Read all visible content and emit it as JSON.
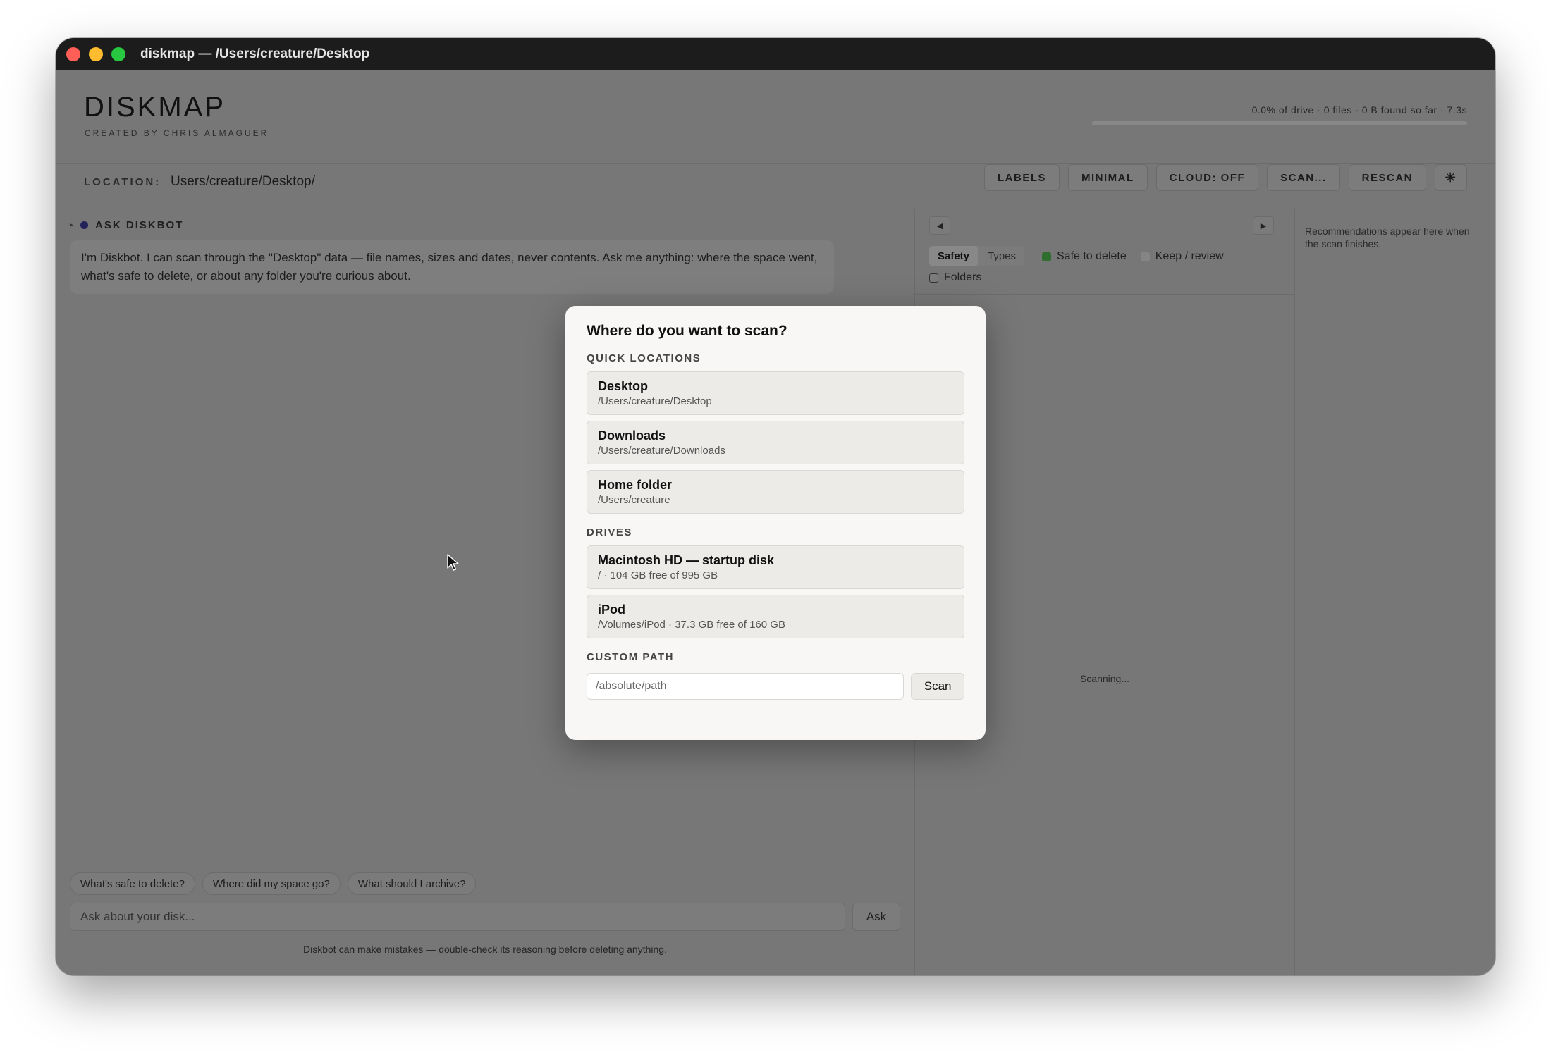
{
  "window": {
    "title": "diskmap — /Users/creature/Desktop"
  },
  "header": {
    "title": "DISKMAP",
    "subtitle": "CREATED BY CHRIS ALMAGUER",
    "scan_status": "0.0% of drive · 0 files · 0 B found so far · 7.3s",
    "scan_progress_percent": 0
  },
  "location": {
    "label": "LOCATION:",
    "path": "Users/creature/Desktop/"
  },
  "toolbar": {
    "labels": "LABELS",
    "minimal": "MINIMAL",
    "cloud": "CLOUD: OFF",
    "scan": "SCAN...",
    "rescan": "RESCAN",
    "theme_icon": "☀"
  },
  "chat": {
    "caret": "▸",
    "title": "ASK DISKBOT",
    "message": "I'm Diskbot. I can scan through the \"Desktop\" data — file names, sizes and dates, never contents. Ask me anything: where the space went, what's safe to delete, or about any folder you're curious about.",
    "suggestions": [
      "What's safe to delete?",
      "Where did my space go?",
      "What should I archive?"
    ],
    "input_placeholder": "Ask about your disk...",
    "ask_label": "Ask",
    "disclaimer": "Diskbot can make mistakes — double-check its reasoning before deleting anything."
  },
  "map": {
    "prev_icon": "◀",
    "next_icon": "▶",
    "tabs": [
      {
        "label": "Safety",
        "active": true
      },
      {
        "label": "Types",
        "active": false
      }
    ],
    "legend": [
      {
        "label": "Safe to delete",
        "color": "#2f6e2f"
      },
      {
        "label": "Keep / review",
        "color": "#858585"
      }
    ],
    "folders_label": "Folders",
    "status": "Scanning..."
  },
  "recommendations": {
    "text": "Recommendations appear here when the scan finishes."
  },
  "modal": {
    "title": "Where do you want to scan?",
    "quick_label": "QUICK LOCATIONS",
    "quick": [
      {
        "name": "Desktop",
        "path": "/Users/creature/Desktop"
      },
      {
        "name": "Downloads",
        "path": "/Users/creature/Downloads"
      },
      {
        "name": "Home folder",
        "path": "/Users/creature"
      }
    ],
    "drives_label": "DRIVES",
    "drives": [
      {
        "name": "Macintosh HD — startup disk",
        "path": "/ · 104 GB free of 995 GB"
      },
      {
        "name": "iPod",
        "path": "/Volumes/iPod · 37.3 GB free of 160 GB"
      }
    ],
    "custom_label": "CUSTOM PATH",
    "custom_placeholder": "/absolute/path",
    "scan_label": "Scan"
  }
}
